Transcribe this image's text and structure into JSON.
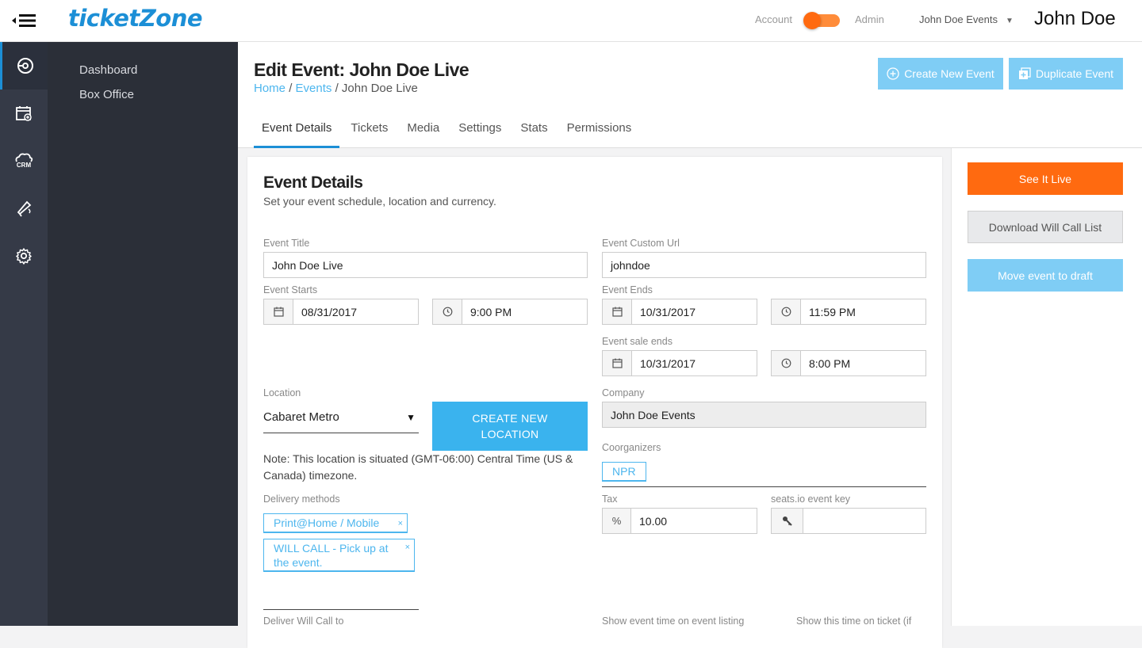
{
  "brand": {
    "logo": "ticketZone"
  },
  "topbar": {
    "account_label": "Account",
    "admin_label": "Admin",
    "org": "John Doe Events",
    "user": "John Doe"
  },
  "sidebar": {
    "icons": [
      "dashboard-icon",
      "calendar-icon",
      "crm-icon",
      "megaphone-icon",
      "gear-icon"
    ],
    "crm_text": "CRM",
    "items": [
      {
        "label": "Dashboard"
      },
      {
        "label": "Box Office"
      }
    ]
  },
  "header": {
    "title": "Edit Event: John Doe Live",
    "breadcrumb": {
      "home": "Home",
      "sep": "/",
      "events": "Events",
      "current": "John Doe Live"
    },
    "create_btn": "Create New Event",
    "duplicate_btn": "Duplicate Event"
  },
  "tabs": [
    {
      "label": "Event Details"
    },
    {
      "label": "Tickets"
    },
    {
      "label": "Media"
    },
    {
      "label": "Settings"
    },
    {
      "label": "Stats"
    },
    {
      "label": "Permissions"
    }
  ],
  "right": {
    "live": "See It Live",
    "download": "Download Will Call List",
    "draft": "Move event to draft"
  },
  "form": {
    "title": "Event Details",
    "subtitle": "Set your event schedule, location and currency.",
    "event_title": {
      "label": "Event Title",
      "value": "John Doe Live"
    },
    "custom_url": {
      "label": "Event Custom Url",
      "value": "johndoe"
    },
    "starts": {
      "label": "Event Starts",
      "date": "08/31/2017",
      "time": "9:00 PM"
    },
    "ends": {
      "label": "Event Ends",
      "date": "10/31/2017",
      "time": "11:59 PM"
    },
    "sale_ends": {
      "label": "Event sale ends",
      "date": "10/31/2017",
      "time": "8:00 PM"
    },
    "location": {
      "label": "Location",
      "value": "Cabaret Metro",
      "new_btn_line1": "CREATE NEW",
      "new_btn_line2": "LOCATION"
    },
    "note": "Note: This location is situated (GMT-06:00) Central Time (US & Canada) timezone.",
    "company": {
      "label": "Company",
      "value": "John Doe Events"
    },
    "coorganizers": {
      "label": "Coorganizers",
      "chips": [
        "NPR"
      ]
    },
    "delivery": {
      "label": "Delivery methods",
      "chips": [
        "Print@Home / Mobile",
        "WILL CALL - Pick up at the event."
      ],
      "remove": "×"
    },
    "tax": {
      "label": "Tax",
      "addon": "%",
      "value": "10.00"
    },
    "seats": {
      "label": "seats.io event key",
      "value": ""
    },
    "will_call_to": {
      "label": "Deliver Will Call to"
    },
    "show_time_listing": {
      "label": "Show event time on event listing"
    },
    "show_time_ticket": {
      "label": "Show this time on ticket (if"
    }
  },
  "colors": {
    "accent": "#1c8fd6",
    "orange": "#ff6a10",
    "light_blue": "#7fcdf5",
    "btn_blue": "#3ab3ee",
    "sidebar": "#2b2f38",
    "iconbar": "#353a47"
  }
}
